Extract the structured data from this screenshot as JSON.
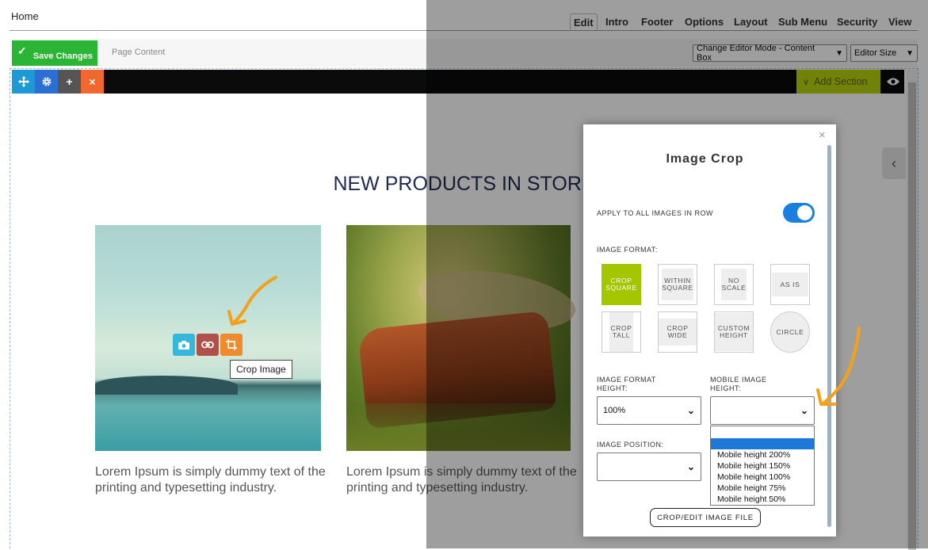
{
  "header": {
    "breadcrumb": "Home",
    "tabs": [
      {
        "label": "Edit",
        "active": true
      },
      {
        "label": "Intro"
      },
      {
        "label": "Footer"
      },
      {
        "label": "Options"
      },
      {
        "label": "Layout"
      },
      {
        "label": "Sub Menu"
      },
      {
        "label": "Security"
      },
      {
        "label": "View"
      }
    ]
  },
  "subbar": {
    "save_label": "Save Changes",
    "page_content_label": "Page Content",
    "editor_mode_value": "Change Editor Mode - Content Box",
    "editor_size_value": "Editor Size"
  },
  "editor_toolbar": {
    "move_icon": "move-icon",
    "settings_icon": "gear-icon",
    "add_glyph": "+",
    "remove_glyph": "×",
    "add_section_label": "Add Section",
    "preview_icon": "eye-icon",
    "colors": {
      "move": "#1d9ad6",
      "settings": "#2a6fd1",
      "add": "#555555",
      "remove": "#f0682f",
      "add_section": "#b8d20e"
    }
  },
  "content": {
    "heading": "NEW PRODUCTS IN STORE",
    "image_tools": [
      "camera-icon",
      "link-icon",
      "crop-icon"
    ],
    "tooltip": "Crop Image",
    "paragraph_1": "Lorem Ipsum is simply dummy text of the printing and typesetting industry.",
    "paragraph_2": "Lorem Ipsum is simply dummy text of the printing and typesetting industry."
  },
  "modal": {
    "title": "Image Crop",
    "close_glyph": "×",
    "apply_all_label": "APPLY TO ALL IMAGES IN ROW",
    "apply_all_on": true,
    "image_format_label": "IMAGE FORMAT:",
    "formats": [
      {
        "label": "CROP SQUARE",
        "selected": true
      },
      {
        "label": "WITHIN SQUARE"
      },
      {
        "label": "NO SCALE"
      },
      {
        "label": "AS IS"
      },
      {
        "label": "CROP TALL"
      },
      {
        "label": "CROP WIDE"
      },
      {
        "label": "CUSTOM HEIGHT"
      },
      {
        "label": "CIRCLE"
      }
    ],
    "format_height_label": "IMAGE FORMAT HEIGHT:",
    "format_height_value": "100%",
    "mobile_height_label": "MOBILE IMAGE HEIGHT:",
    "mobile_height_value": "",
    "mobile_options": [
      "",
      "Mobile height 200%",
      "Mobile height 150%",
      "Mobile height 100%",
      "Mobile height 75%",
      "Mobile height 50%"
    ],
    "image_position_label": "IMAGE POSITION:",
    "image_position_value": "",
    "crop_button": "CROP/EDIT IMAGE FILE"
  },
  "accent_colors": {
    "annotation_arrow": "#f4a11a",
    "selected_format": "#a3c600",
    "toggle": "#1b7fe0"
  }
}
